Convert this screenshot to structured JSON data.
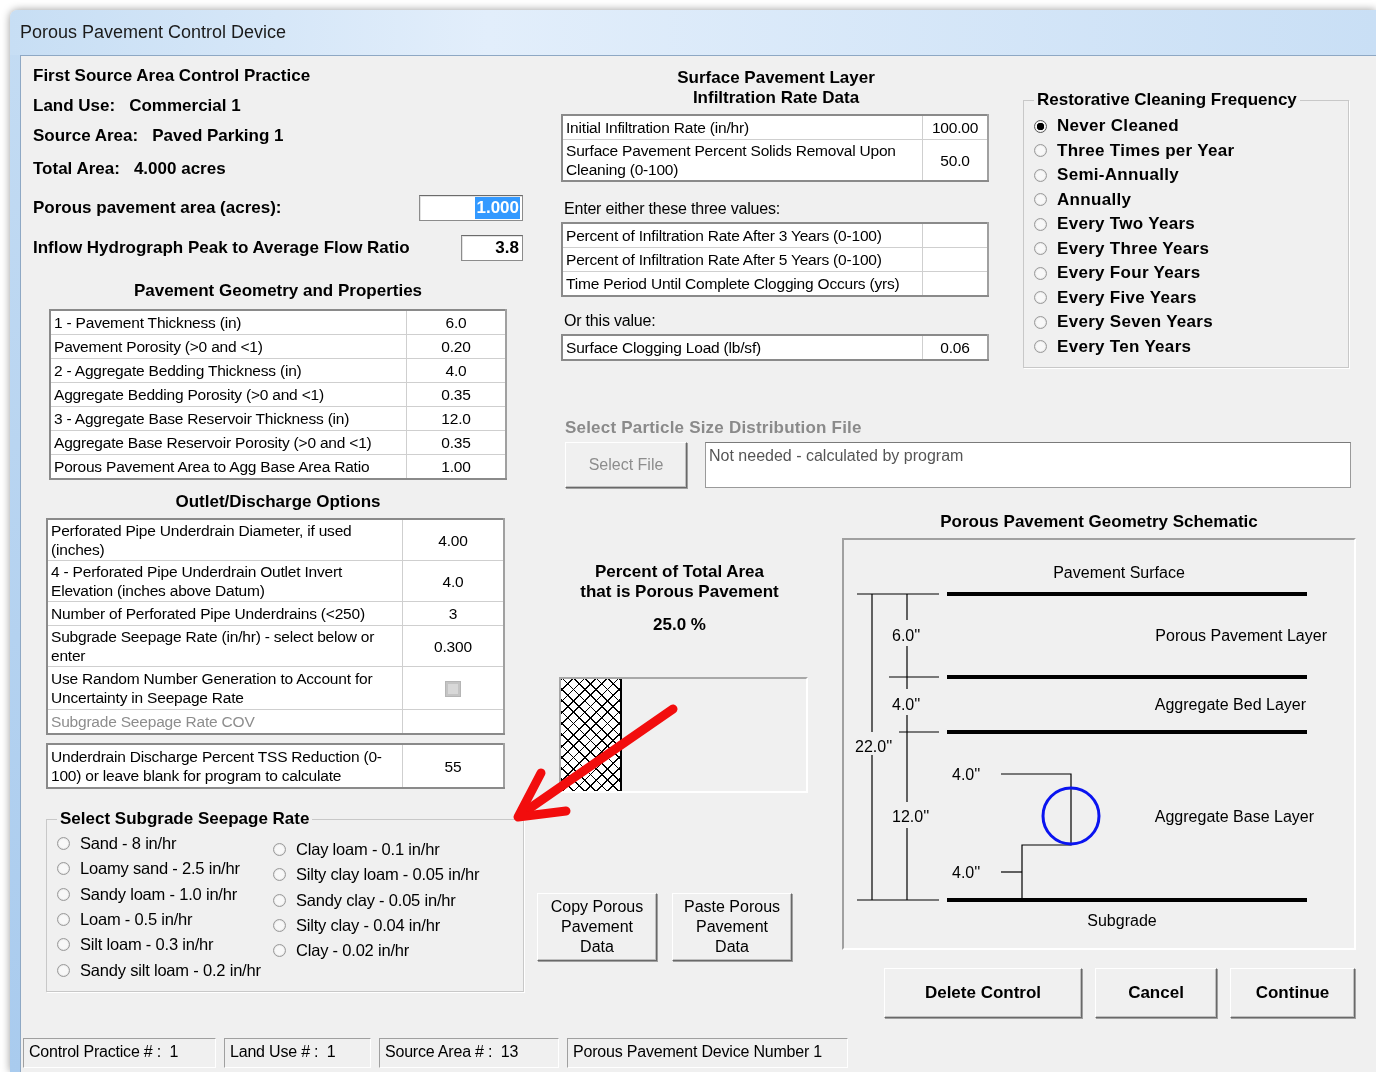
{
  "window": {
    "title": "Porous Pavement Control Device"
  },
  "header": {
    "title": "First Source Area Control Practice",
    "fields": [
      {
        "label": "Land Use:",
        "value": "Commercial 1"
      },
      {
        "label": "Source Area:",
        "value": "Paved Parking 1"
      },
      {
        "label": "Total Area:",
        "value": "4.000 acres"
      }
    ]
  },
  "inputs": [
    {
      "label": "Porous pavement area (acres):",
      "value": "1.000",
      "text_selected": true
    },
    {
      "label": "Inflow Hydrograph Peak to Average Flow Ratio",
      "value": "3.8",
      "text_selected": false
    }
  ],
  "geometry": {
    "title": "Pavement Geometry and Properties",
    "rows": [
      {
        "label": "1 - Pavement Thickness (in)",
        "value": "6.0"
      },
      {
        "label": "Pavement Porosity (>0 and <1)",
        "value": "0.20"
      },
      {
        "label": "2 - Aggregate Bedding Thickness (in)",
        "value": "4.0"
      },
      {
        "label": "Aggregate Bedding Porosity (>0 and <1)",
        "value": "0.35"
      },
      {
        "label": "3 - Aggregate Base Reservoir Thickness (in)",
        "value": "12.0"
      },
      {
        "label": "Aggregate Base Reservoir Porosity  (>0 and <1)",
        "value": "0.35"
      },
      {
        "label": "Porous Pavement Area to Agg Base Area Ratio",
        "value": "1.00"
      }
    ]
  },
  "outlet": {
    "title": "Outlet/Discharge Options",
    "rows": [
      {
        "kind": "value",
        "label": "Perforated Pipe Underdrain Diameter, if used (inches)",
        "value": "4.00",
        "disabled": false
      },
      {
        "kind": "value",
        "label": "4 - Perforated Pipe Underdrain Outlet Invert Elevation (inches above Datum)",
        "value": "4.0",
        "disabled": false
      },
      {
        "kind": "value",
        "label": "Number of Perforated Pipe Underdrains (<250)",
        "value": "3",
        "disabled": false
      },
      {
        "kind": "value",
        "label": "Subgrade Seepage Rate (in/hr) - select below or enter",
        "value": "0.300",
        "disabled": false
      },
      {
        "kind": "checkbox",
        "label": "Use Random Number Generation to Account for Uncertainty in Seepage Rate",
        "checked": false,
        "disabled": false
      },
      {
        "kind": "value",
        "label": "Subgrade Seepage Rate COV",
        "disabled": true
      }
    ],
    "tss": {
      "label": "Underdrain Discharge Percent TSS Reduction (0-100) or leave blank for program to calculate",
      "value": "55"
    }
  },
  "seepage_select": {
    "title": "Select Subgrade Seepage Rate",
    "columns": [
      [
        {
          "label": "Sand - 8 in/hr",
          "selected": false
        },
        {
          "label": "Loamy sand - 2.5 in/hr",
          "selected": false
        },
        {
          "label": "Sandy loam - 1.0 in/hr",
          "selected": false
        },
        {
          "label": "Loam - 0.5 in/hr",
          "selected": false
        },
        {
          "label": "Silt loam - 0.3 in/hr",
          "selected": false
        },
        {
          "label": "Sandy silt loam - 0.2 in/hr",
          "selected": false
        }
      ],
      [
        {
          "label": "Clay loam - 0.1 in/hr",
          "selected": false
        },
        {
          "label": "Silty clay loam - 0.05 in/hr",
          "selected": false
        },
        {
          "label": "Sandy clay - 0.05 in/hr",
          "selected": false
        },
        {
          "label": "Silty clay - 0.04 in/hr",
          "selected": false
        },
        {
          "label": "Clay - 0.02 in/hr",
          "selected": false
        }
      ]
    ]
  },
  "infiltration": {
    "title": [
      "Surface Pavement Layer",
      "Infiltration Rate Data"
    ],
    "rows": [
      {
        "label": "Initial Infiltration Rate (in/hr)",
        "value": "100.00"
      },
      {
        "label": "Surface Pavement Percent Solids Removal Upon Cleaning (0-100)",
        "value": "50.0"
      }
    ],
    "either_label": "Enter either these three values:",
    "either_rows": [
      {
        "label": "Percent of Infiltration Rate After 3 Years (0-100)"
      },
      {
        "label": "Percent of Infiltration Rate After 5 Years (0-100)"
      },
      {
        "label": "Time Period Until Complete Clogging Occurs (yrs)"
      }
    ],
    "or_label": "Or this value:",
    "or_rows": [
      {
        "label": "Surface Clogging Load (lb/sf)",
        "value": "0.06"
      }
    ]
  },
  "cleaning": {
    "title": "Restorative Cleaning Frequency",
    "options": [
      {
        "label": "Never Cleaned",
        "selected": true
      },
      {
        "label": "Three Times per Year",
        "selected": false
      },
      {
        "label": "Semi-Annually",
        "selected": false
      },
      {
        "label": "Annually",
        "selected": false
      },
      {
        "label": "Every Two Years",
        "selected": false
      },
      {
        "label": "Every Three Years",
        "selected": false
      },
      {
        "label": "Every Four Years",
        "selected": false
      },
      {
        "label": "Every Five Years",
        "selected": false
      },
      {
        "label": "Every Seven Years",
        "selected": false
      },
      {
        "label": "Every Ten Years",
        "selected": false
      }
    ]
  },
  "particle_file": {
    "title": "Select Particle Size Distribution File",
    "button": "Select File",
    "value": "Not needed - calculated by program",
    "disabled": true
  },
  "porous_share": {
    "title": [
      "Percent of Total Area",
      "that is Porous Pavement"
    ],
    "value": "25.0 %",
    "level": 0.25
  },
  "copy_buttons": [
    "Copy Porous Pavement Data",
    "Paste Porous Pavement Data"
  ],
  "schematic": {
    "title": "Porous Pavement Geometry  Schematic",
    "surface_label": "Pavement Surface",
    "layers": [
      {
        "name": "Porous Pavement Layer",
        "thickness": "6.0''"
      },
      {
        "name": "Aggregate Bed Layer",
        "thickness": "4.0''"
      },
      {
        "name": "Aggregate Base Layer",
        "thickness": "12.0''"
      }
    ],
    "total_thickness": "22.0''",
    "pipe_diameter": "4.0''",
    "pipe_invert": "4.0''",
    "subgrade_label": "Subgrade"
  },
  "actions": [
    "Delete Control",
    "Cancel",
    "Continue"
  ],
  "status_bar": [
    "Control Practice # :  1",
    "Land Use # :  1",
    "Source Area # :  13",
    "Porous Pavement Device Number 1"
  ]
}
